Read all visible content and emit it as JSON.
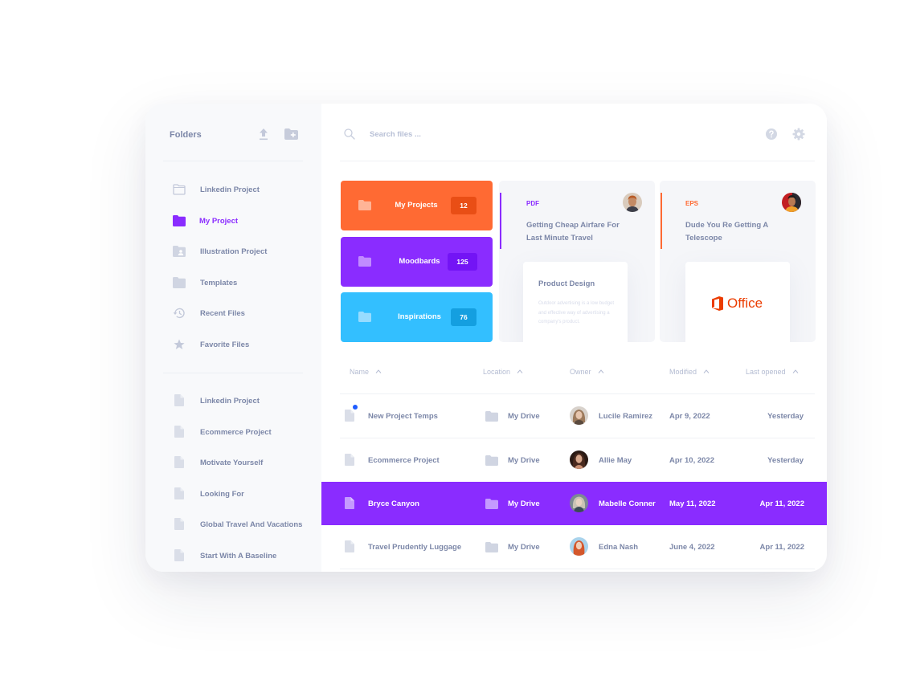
{
  "sidebar": {
    "title": "Folders",
    "folders": [
      {
        "label": "Linkedin Project",
        "icon": "folder-outline-icon",
        "active": false
      },
      {
        "label": "My Project",
        "icon": "folder-icon",
        "active": true
      },
      {
        "label": "Illustration Project",
        "icon": "shared-folder-icon",
        "active": false
      },
      {
        "label": "Templates",
        "icon": "folder-icon",
        "active": false
      },
      {
        "label": "Recent Files",
        "icon": "history-icon",
        "active": false
      },
      {
        "label": "Favorite Files",
        "icon": "star-icon",
        "active": false
      }
    ],
    "files": [
      {
        "label": "Linkedin Project"
      },
      {
        "label": "Ecommerce Project"
      },
      {
        "label": "Motivate Yourself"
      },
      {
        "label": "Looking For"
      },
      {
        "label": "Global Travel And Vacations"
      },
      {
        "label": "Start With A Baseline"
      }
    ]
  },
  "header": {
    "search_placeholder": "Search files ..."
  },
  "folder_tiles": [
    {
      "label": "My Projects",
      "count": "12",
      "color": "#ff6a33",
      "badge_color": "#e94e15",
      "icon_color": "#ffb497"
    },
    {
      "label": "Moodbards",
      "count": "125",
      "color": "#8a2cff",
      "badge_color": "#7314f5",
      "icon_color": "#c18bff"
    },
    {
      "label": "Inspirations",
      "count": "76",
      "color": "#33bfff",
      "badge_color": "#149fe0",
      "icon_color": "#97dcff"
    }
  ],
  "file_cards": [
    {
      "type": "PDF",
      "type_color": "#8a2cff",
      "title": "Getting Cheap Airfare For Last Minute Travel",
      "preview_title": "Product Design",
      "preview_body": "Outdoor advertising is a low budget and effective way of advertising a company's product."
    },
    {
      "type": "EPS",
      "type_color": "#ff6a33",
      "title": "Dude You Re Getting A Telescope",
      "preview_logo": "Office"
    }
  ],
  "table": {
    "columns": [
      "Name",
      "Location",
      "Owner",
      "Modified",
      "Last opened"
    ],
    "rows": [
      {
        "name": "New Project Temps",
        "location": "My Drive",
        "owner": "Lucile Ramirez",
        "modified": "Apr 9, 2022",
        "last_opened": "Yesterday",
        "unread": true,
        "selected": false
      },
      {
        "name": "Ecommerce Project",
        "location": "My Drive",
        "owner": "Allie May",
        "modified": "Apr 10, 2022",
        "last_opened": "Yesterday",
        "unread": false,
        "selected": false
      },
      {
        "name": "Bryce Canyon",
        "location": "My Drive",
        "owner": "Mabelle Conner",
        "modified": "May 11, 2022",
        "last_opened": "Apr 11, 2022",
        "unread": false,
        "selected": true
      },
      {
        "name": "Travel Prudently Luggage",
        "location": "My Drive",
        "owner": "Edna Nash",
        "modified": "June 4, 2022",
        "last_opened": "Apr 11, 2022",
        "unread": false,
        "selected": false
      }
    ]
  },
  "colors": {
    "accent": "#8a2cff",
    "text_muted": "#7c87a8",
    "unread_dot": "#1f5cff"
  }
}
